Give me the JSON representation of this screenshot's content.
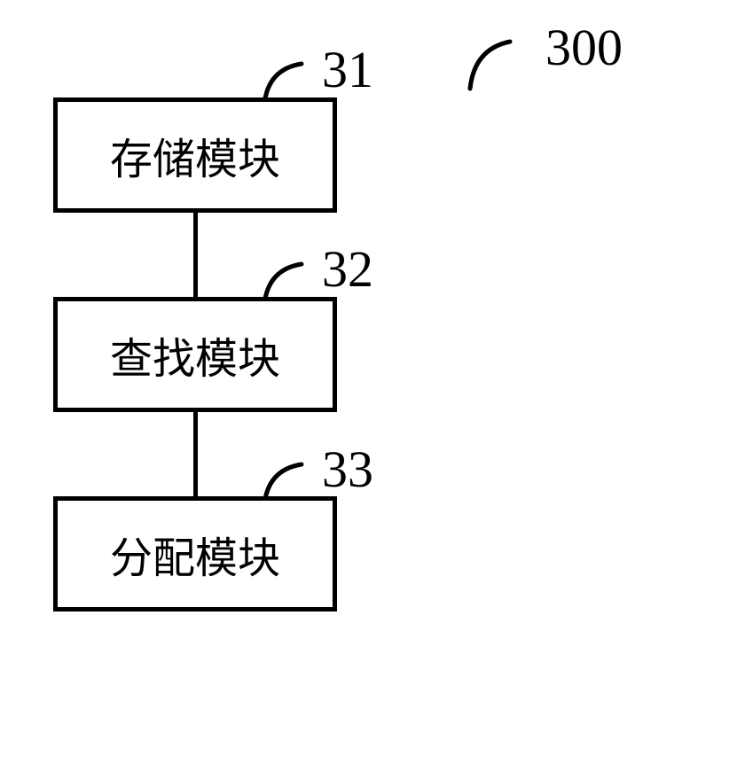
{
  "diagram": {
    "main_label": "300",
    "blocks": [
      {
        "id": "31",
        "label": "存储模块"
      },
      {
        "id": "32",
        "label": "查找模块"
      },
      {
        "id": "33",
        "label": "分配模块"
      }
    ]
  }
}
